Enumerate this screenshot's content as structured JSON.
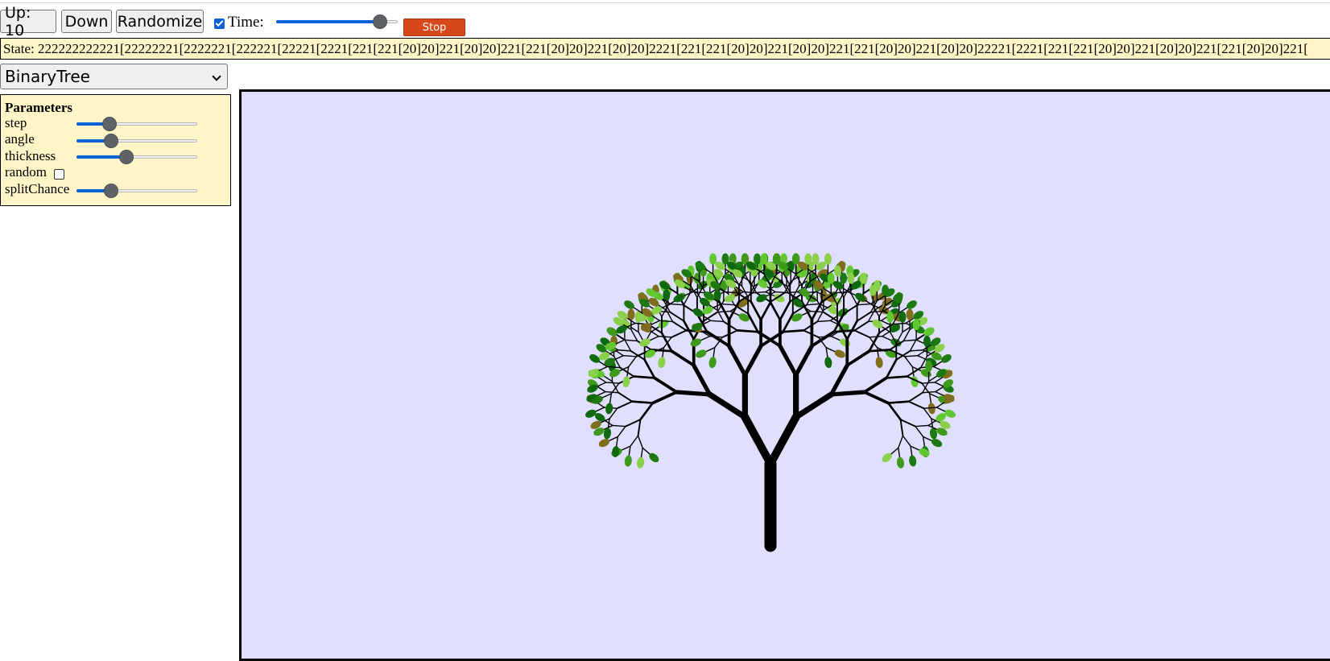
{
  "toolbar": {
    "up_label": "Up: 10",
    "down_label": "Down",
    "randomize_label": "Randomize",
    "time_label": "Time:",
    "time_checked": true,
    "time_value": 0.9,
    "stop_label": "Stop"
  },
  "state_text": "State: 222222222221[22222221[2222221[222221[22221[2221[221[221[20]20]221[20]20]221[221[20]20]221[20]20]2221[221[221[20]20]221[20]20]221[221[20]20]221[20]20]22221[2221[221[221[20]20]221[20]20]221[221[20]20]221[",
  "system": {
    "selected": "BinaryTree"
  },
  "parameters": {
    "title": "Parameters",
    "items": [
      {
        "label": "step",
        "type": "slider",
        "value": 0.24
      },
      {
        "label": "angle",
        "type": "slider",
        "value": 0.26
      },
      {
        "label": "thickness",
        "type": "slider",
        "value": 0.4
      },
      {
        "label": "random",
        "type": "checkbox",
        "checked": false
      },
      {
        "label": "splitChance",
        "type": "slider",
        "value": 0.26
      }
    ]
  },
  "canvas": {
    "background": "#e0e0fe",
    "branch_color": "#000000",
    "leaf_colors": [
      "#1d7a12",
      "#3f9a1c",
      "#62c832",
      "#806e1e",
      "#0f6a0f",
      "#8ad04a"
    ]
  }
}
